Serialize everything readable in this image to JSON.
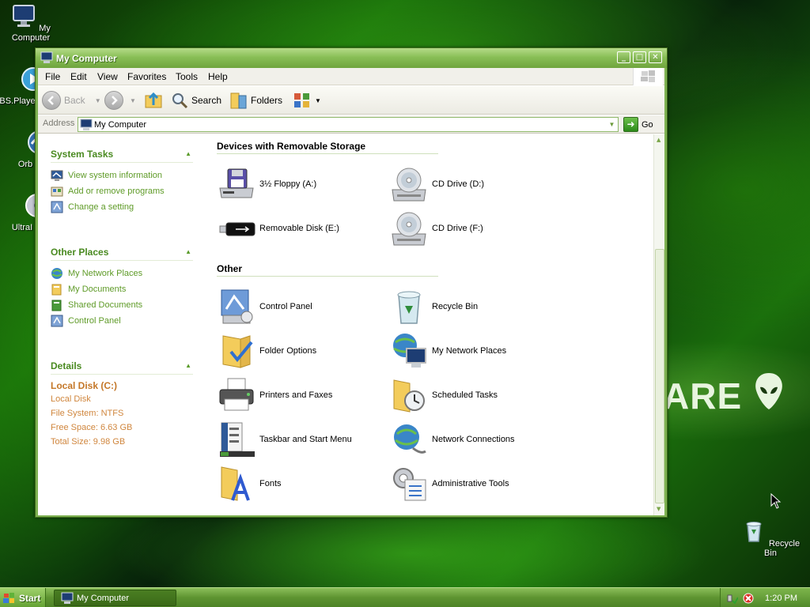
{
  "desktop": {
    "icons": [
      {
        "label": "My Computer"
      },
      {
        "label": "BS.Playe"
      },
      {
        "label": "Orb"
      },
      {
        "label": "UltraI"
      },
      {
        "label": "Recycle Bin"
      }
    ],
    "wallpaper_text": "ARE"
  },
  "window": {
    "title": "My Computer",
    "buttons": {
      "minimize": "_",
      "maximize": "□",
      "close": "✕"
    },
    "menu": [
      "File",
      "Edit",
      "View",
      "Favorites",
      "Tools",
      "Help"
    ],
    "toolbar": {
      "back": "Back",
      "search": "Search",
      "folders": "Folders"
    },
    "address": {
      "label": "Address",
      "value": "My Computer",
      "go": "Go"
    }
  },
  "taskpane": {
    "system_tasks": {
      "title": "System Tasks",
      "links": [
        "View system information",
        "Add or remove programs",
        "Change a setting"
      ]
    },
    "other_places": {
      "title": "Other Places",
      "links": [
        "My Network Places",
        "My Documents",
        "Shared Documents",
        "Control Panel"
      ]
    },
    "details": {
      "title": "Details",
      "name": "Local Disk (C:)",
      "type": "Local Disk",
      "file_system": "File System: NTFS",
      "free_space": "Free Space: 6.63 GB",
      "total_size": "Total Size: 9.98 GB"
    }
  },
  "content": {
    "groups": [
      {
        "title": "Devices with Removable Storage",
        "items": [
          {
            "label": "3½ Floppy (A:)",
            "icon": "floppy-drive-icon"
          },
          {
            "label": "CD Drive (D:)",
            "icon": "cd-drive-icon"
          },
          {
            "label": "Removable Disk (E:)",
            "icon": "usb-drive-icon"
          },
          {
            "label": "CD Drive (F:)",
            "icon": "cd-drive-icon"
          }
        ]
      },
      {
        "title": "Other",
        "items": [
          {
            "label": "Control Panel",
            "icon": "control-panel-icon"
          },
          {
            "label": "Recycle Bin",
            "icon": "recycle-bin-icon"
          },
          {
            "label": "Folder Options",
            "icon": "folder-options-icon"
          },
          {
            "label": "My Network Places",
            "icon": "network-places-icon"
          },
          {
            "label": "Printers and Faxes",
            "icon": "printer-icon"
          },
          {
            "label": "Scheduled Tasks",
            "icon": "scheduled-tasks-icon"
          },
          {
            "label": "Taskbar and Start Menu",
            "icon": "taskbar-icon"
          },
          {
            "label": "Network Connections",
            "icon": "network-connections-icon"
          },
          {
            "label": "Fonts",
            "icon": "fonts-icon"
          },
          {
            "label": "Administrative Tools",
            "icon": "admin-tools-icon"
          }
        ]
      }
    ]
  },
  "taskbar": {
    "start": "Start",
    "task_button": "My Computer",
    "clock": "1:20 PM"
  },
  "colors": {
    "link_green": "#5f9b28",
    "header_green": "#4a8a21",
    "detail_orange": "#d0863d",
    "title_bar": "#89bf57"
  }
}
